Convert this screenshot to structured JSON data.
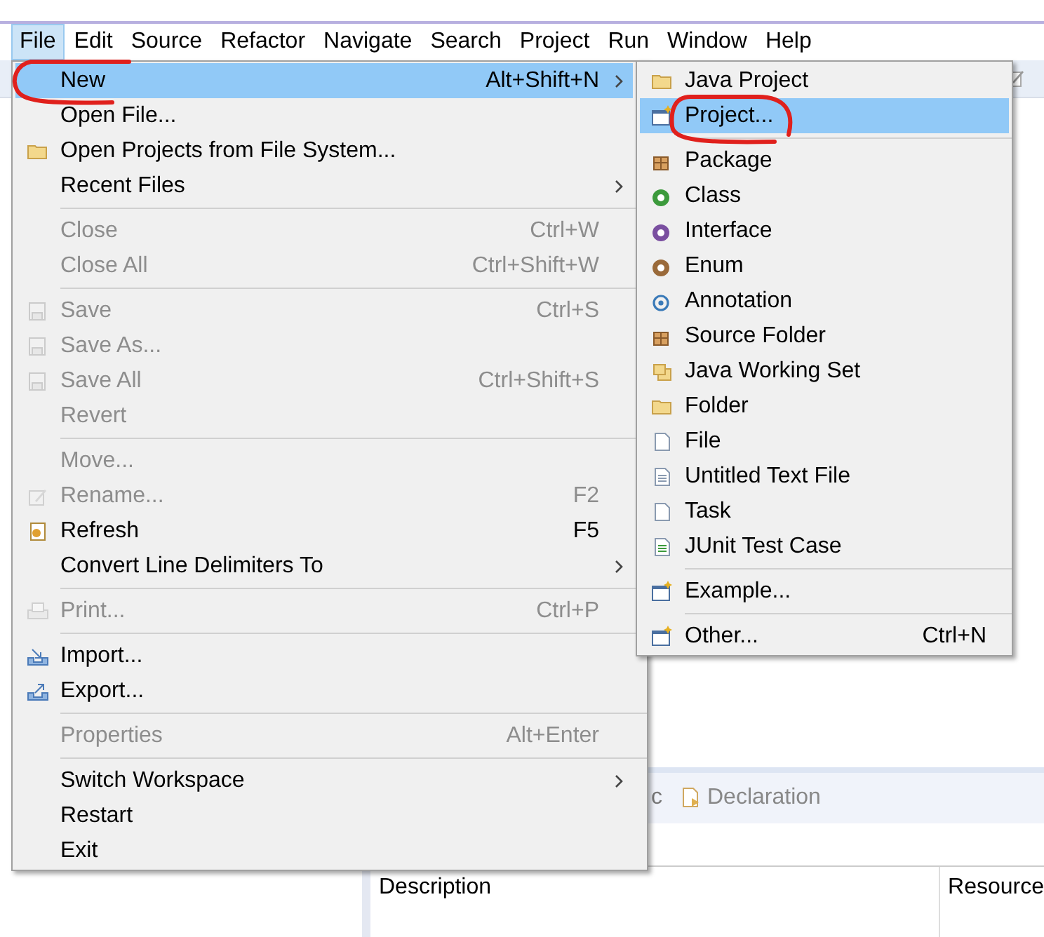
{
  "menubar": [
    {
      "label": "File",
      "selected": true
    },
    {
      "label": "Edit",
      "selected": false
    },
    {
      "label": "Source",
      "selected": false
    },
    {
      "label": "Refactor",
      "selected": false
    },
    {
      "label": "Navigate",
      "selected": false
    },
    {
      "label": "Search",
      "selected": false
    },
    {
      "label": "Project",
      "selected": false
    },
    {
      "label": "Run",
      "selected": false
    },
    {
      "label": "Window",
      "selected": false
    },
    {
      "label": "Help",
      "selected": false
    }
  ],
  "file_menu": [
    {
      "kind": "item",
      "label": "New",
      "shortcut": "Alt+Shift+N",
      "submenu": true,
      "selected": true,
      "disabled": false
    },
    {
      "kind": "item",
      "label": "Open File...",
      "submenu": false,
      "selected": false,
      "disabled": false
    },
    {
      "kind": "item",
      "label": "Open Projects from File System...",
      "submenu": false,
      "selected": false,
      "disabled": false
    },
    {
      "kind": "item",
      "label": "Recent Files",
      "submenu": true,
      "selected": false,
      "disabled": false
    },
    {
      "kind": "separator"
    },
    {
      "kind": "item",
      "label": "Close",
      "shortcut": "Ctrl+W",
      "submenu": false,
      "selected": false,
      "disabled": true
    },
    {
      "kind": "item",
      "label": "Close All",
      "shortcut": "Ctrl+Shift+W",
      "submenu": false,
      "selected": false,
      "disabled": true
    },
    {
      "kind": "separator"
    },
    {
      "kind": "item",
      "label": "Save",
      "shortcut": "Ctrl+S",
      "submenu": false,
      "selected": false,
      "disabled": true
    },
    {
      "kind": "item",
      "label": "Save As...",
      "submenu": false,
      "selected": false,
      "disabled": true
    },
    {
      "kind": "item",
      "label": "Save All",
      "shortcut": "Ctrl+Shift+S",
      "submenu": false,
      "selected": false,
      "disabled": true
    },
    {
      "kind": "item",
      "label": "Revert",
      "submenu": false,
      "selected": false,
      "disabled": true
    },
    {
      "kind": "separator"
    },
    {
      "kind": "item",
      "label": "Move...",
      "submenu": false,
      "selected": false,
      "disabled": true
    },
    {
      "kind": "item",
      "label": "Rename...",
      "shortcut": "F2",
      "submenu": false,
      "selected": false,
      "disabled": true
    },
    {
      "kind": "item",
      "label": "Refresh",
      "shortcut": "F5",
      "submenu": false,
      "selected": false,
      "disabled": false
    },
    {
      "kind": "item",
      "label": "Convert Line Delimiters To",
      "submenu": true,
      "selected": false,
      "disabled": false
    },
    {
      "kind": "separator"
    },
    {
      "kind": "item",
      "label": "Print...",
      "shortcut": "Ctrl+P",
      "submenu": false,
      "selected": false,
      "disabled": true
    },
    {
      "kind": "separator"
    },
    {
      "kind": "item",
      "label": "Import...",
      "submenu": false,
      "selected": false,
      "disabled": false
    },
    {
      "kind": "item",
      "label": "Export...",
      "submenu": false,
      "selected": false,
      "disabled": false
    },
    {
      "kind": "separator"
    },
    {
      "kind": "item",
      "label": "Properties",
      "shortcut": "Alt+Enter",
      "submenu": false,
      "selected": false,
      "disabled": true
    },
    {
      "kind": "separator"
    },
    {
      "kind": "item",
      "label": "Switch Workspace",
      "submenu": true,
      "selected": false,
      "disabled": false
    },
    {
      "kind": "item",
      "label": "Restart",
      "submenu": false,
      "selected": false,
      "disabled": false
    },
    {
      "kind": "item",
      "label": "Exit",
      "submenu": false,
      "selected": false,
      "disabled": false
    }
  ],
  "new_submenu": [
    {
      "kind": "item",
      "label": "Java Project",
      "selected": false
    },
    {
      "kind": "item",
      "label": "Project...",
      "selected": true
    },
    {
      "kind": "separator"
    },
    {
      "kind": "item",
      "label": "Package",
      "selected": false
    },
    {
      "kind": "item",
      "label": "Class",
      "selected": false
    },
    {
      "kind": "item",
      "label": "Interface",
      "selected": false
    },
    {
      "kind": "item",
      "label": "Enum",
      "selected": false
    },
    {
      "kind": "item",
      "label": "Annotation",
      "selected": false
    },
    {
      "kind": "item",
      "label": "Source Folder",
      "selected": false
    },
    {
      "kind": "item",
      "label": "Java Working Set",
      "selected": false
    },
    {
      "kind": "item",
      "label": "Folder",
      "selected": false
    },
    {
      "kind": "item",
      "label": "File",
      "selected": false
    },
    {
      "kind": "item",
      "label": "Untitled Text File",
      "selected": false
    },
    {
      "kind": "item",
      "label": "Task",
      "selected": false
    },
    {
      "kind": "item",
      "label": "JUnit Test Case",
      "selected": false
    },
    {
      "kind": "separator"
    },
    {
      "kind": "item",
      "label": "Example...",
      "selected": false
    },
    {
      "kind": "separator"
    },
    {
      "kind": "item",
      "label": "Other...",
      "shortcut": "Ctrl+N",
      "selected": false
    }
  ],
  "view_tabs": [
    {
      "label": "c"
    },
    {
      "label": "Declaration"
    }
  ],
  "table": {
    "columns": [
      "Description",
      "Resource"
    ]
  }
}
